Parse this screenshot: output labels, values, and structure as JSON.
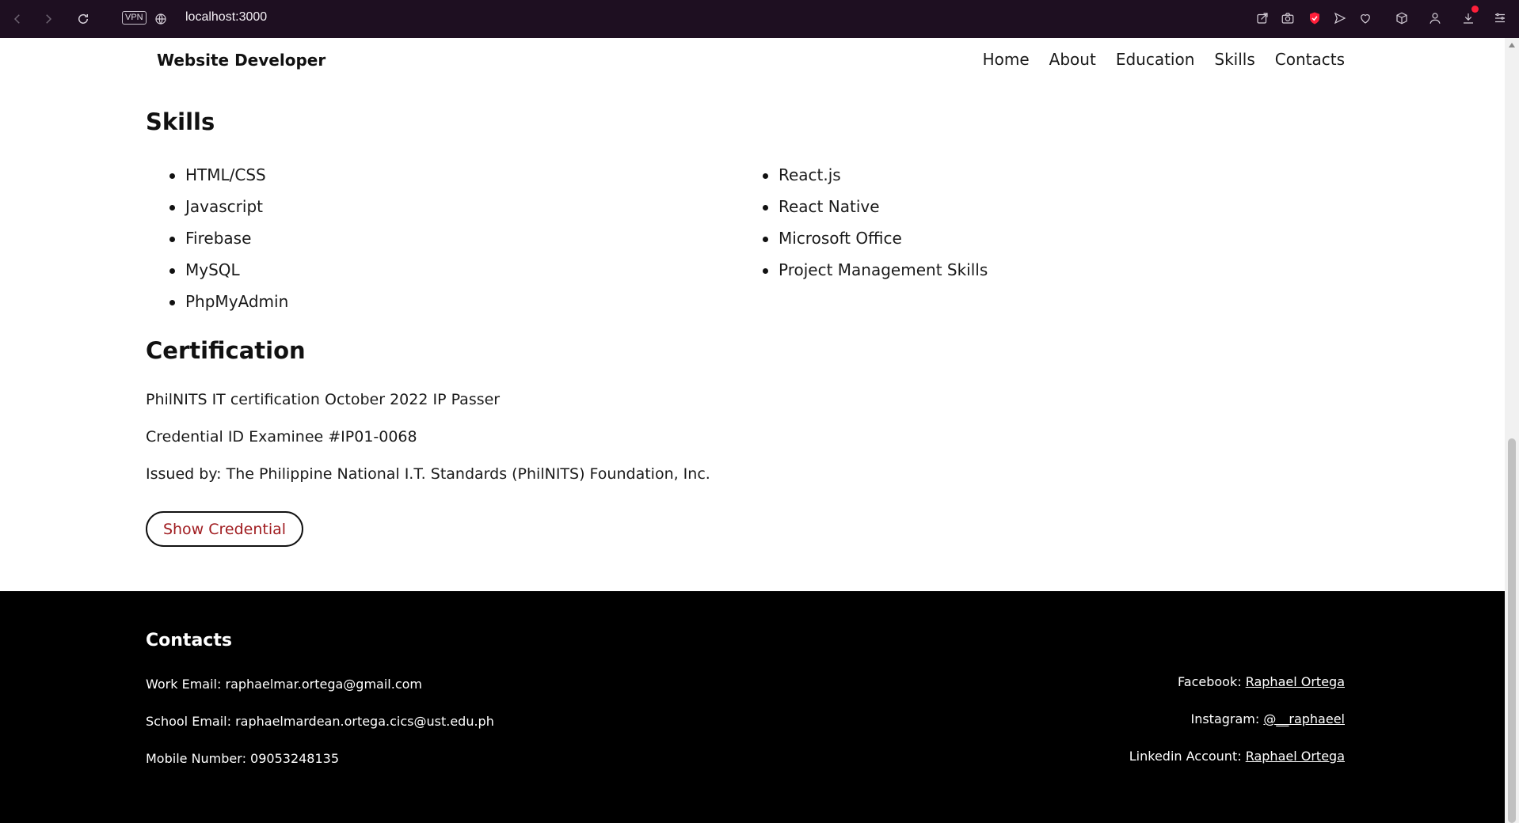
{
  "browser": {
    "url": "localhost:3000",
    "vpn_label": "VPN",
    "accent_color": "#1e0f21"
  },
  "site": {
    "brand": "Website Developer",
    "nav": [
      "Home",
      "About",
      "Education",
      "Skills",
      "Contacts"
    ]
  },
  "skills": {
    "title": "Skills",
    "left_items": [
      "HTML/CSS",
      "Javascript",
      "Firebase",
      "MySQL",
      "PhpMyAdmin"
    ],
    "right_items": [
      "React.js",
      "React Native",
      "Microsoft Office",
      "Project Management Skills"
    ]
  },
  "certification": {
    "title": "Certification",
    "lines": [
      "PhilNITS IT certification October 2022 IP Passer",
      "Credential ID Examinee #IP01-0068",
      "Issued by: The Philippine National I.T. Standards (PhilNITS) Foundation, Inc."
    ],
    "button_label": "Show Credential",
    "button_text_color": "#a01c20"
  },
  "footer": {
    "title": "Contacts",
    "work_email_label": "Work Email:",
    "work_email": "raphaelmar.ortega@gmail.com",
    "school_email_label": "School Email:",
    "school_email": "raphaelmardean.ortega.cics@ust.edu.ph",
    "mobile_label": "Mobile Number:",
    "mobile": "09053248135",
    "facebook_label": "Facebook:",
    "facebook": "Raphael Ortega",
    "instagram_label": "Instagram:",
    "instagram": "@__raphaeel",
    "linkedin_label": "Linkedin Account:",
    "linkedin": "Raphael Ortega"
  }
}
